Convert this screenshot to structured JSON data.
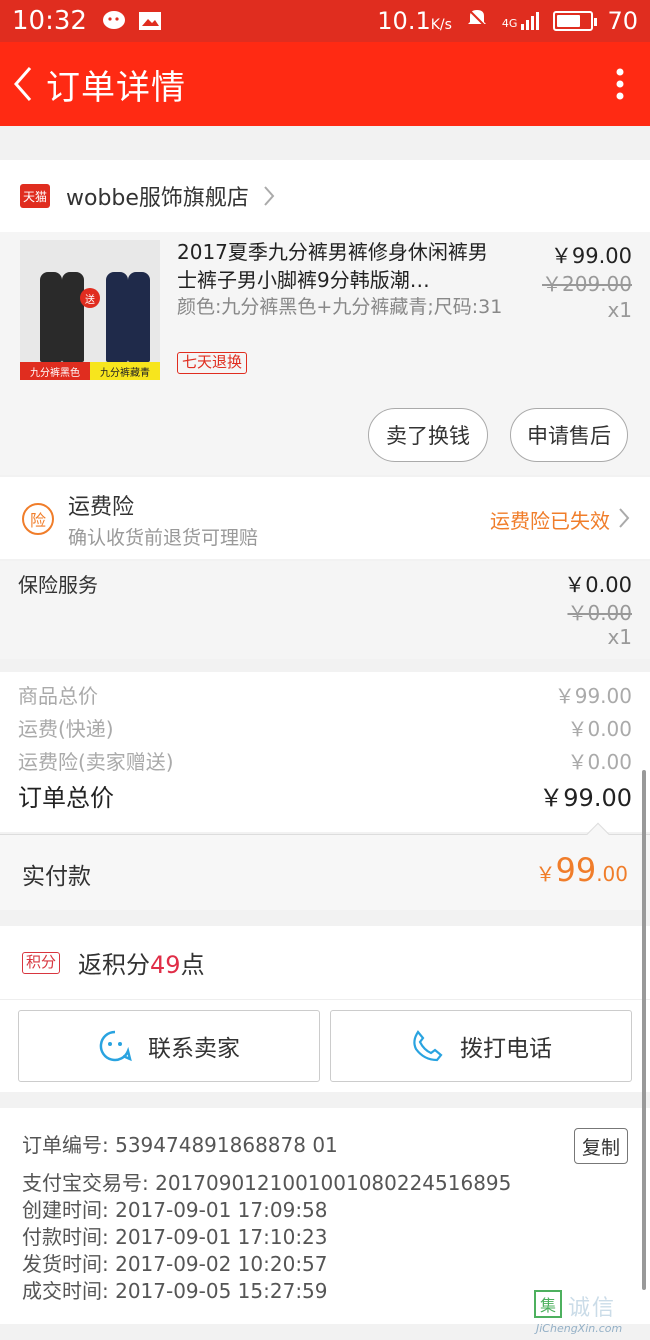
{
  "status_bar": {
    "time": "10:32",
    "net_speed": "10.1",
    "net_speed_unit": "K/s",
    "signal": "4G",
    "battery": "70",
    "battery_level": 0.7
  },
  "nav": {
    "title": "订单详情"
  },
  "shop": {
    "badge": "天猫",
    "name": "wobbe服饰旗舰店"
  },
  "product": {
    "title": "2017夏季九分裤男裤修身休闲裤男士裤子男小脚裤9分韩版潮…",
    "sku": "颜色:九分裤黑色+九分裤藏青;尺码:31",
    "tag": "七天退换",
    "price": "￥99.00",
    "original_price": "￥209.00",
    "quantity": "x1",
    "thumb_gift": "送",
    "thumb_caption_left": "九分裤黑色",
    "thumb_caption_right": "九分裤藏青",
    "actions": [
      "卖了换钱",
      "申请售后"
    ]
  },
  "shipping_insurance": {
    "icon_text": "险",
    "title": "运费险",
    "subtitle": "确认收货前退货可理赔",
    "status": "运费险已失效"
  },
  "insurance_service": {
    "label": "保险服务",
    "price": "￥0.00",
    "original_price": "￥0.00",
    "quantity": "x1"
  },
  "summary": {
    "rows": [
      {
        "label": "商品总价",
        "value": "￥99.00"
      },
      {
        "label": "运费(快递)",
        "value": "￥0.00"
      },
      {
        "label": "运费险(卖家赠送)",
        "value": "￥0.00"
      }
    ],
    "total_label": "订单总价",
    "total_value": "￥99.00"
  },
  "paid": {
    "label": "实付款",
    "currency": "￥",
    "amount_int": "99",
    "amount_dec": ".00"
  },
  "points": {
    "badge": "积分",
    "prefix": "返积分",
    "number": "49",
    "suffix": "点"
  },
  "contact": {
    "seller_label": "联系卖家",
    "call_label": "拨打电话"
  },
  "order_info": {
    "copy_label": "复制",
    "lines": [
      "订单编号: 539474891868878 01",
      "支付宝交易号: 2017090121001001080224516895",
      "创建时间: 2017-09-01 17:09:58",
      "付款时间: 2017-09-01 17:10:23",
      "发货时间: 2017-09-02 10:20:57",
      "成交时间: 2017-09-05 15:27:59"
    ]
  },
  "watermark": {
    "char": "集",
    "cn": "诚信",
    "en": "JiChengXin.com"
  }
}
